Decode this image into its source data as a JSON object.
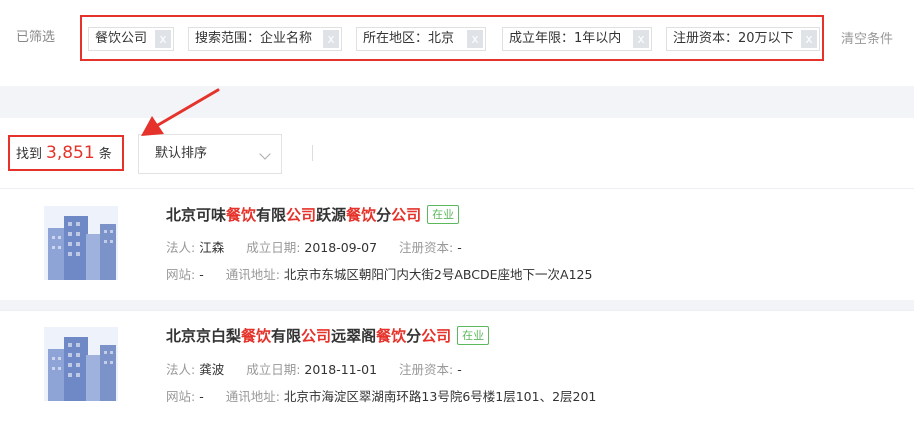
{
  "filters": {
    "label": "已筛选",
    "chips": [
      {
        "text": "餐饮公司",
        "close": "x"
      },
      {
        "text": "搜索范围：企业名称",
        "close": "x"
      },
      {
        "text": "所在地区：北京",
        "close": "x"
      },
      {
        "text": "成立年限：1年以内",
        "close": "x"
      },
      {
        "text": "注册资本：20万以下",
        "close": "x"
      }
    ],
    "clear_label": "清空条件"
  },
  "results": {
    "prefix": "找到",
    "count": "3,851",
    "suffix": "条",
    "sort_label": "默认排序"
  },
  "companies": [
    {
      "name_parts": [
        "北京可味",
        "餐饮",
        "有限",
        "公司",
        "跃源",
        "餐饮",
        "分",
        "公司"
      ],
      "status": "在业",
      "legal_label": "法人:",
      "legal_value": "江森",
      "date_label": "成立日期:",
      "date_value": "2018-09-07",
      "capital_label": "注册资本:",
      "capital_value": "-",
      "site_label": "网站:",
      "site_value": "-",
      "addr_label": "通讯地址:",
      "addr_value": "北京市东城区朝阳门内大街2号ABCDE座地下一次A125"
    },
    {
      "name_parts": [
        "北京京白梨",
        "餐饮",
        "有限",
        "公司",
        "远翠阁",
        "餐饮",
        "分",
        "公司"
      ],
      "status": "在业",
      "legal_label": "法人:",
      "legal_value": "龚波",
      "date_label": "成立日期:",
      "date_value": "2018-11-01",
      "capital_label": "注册资本:",
      "capital_value": "-",
      "site_label": "网站:",
      "site_value": "-",
      "addr_label": "通讯地址:",
      "addr_value": "北京市海淀区翠湖南环路13号院6号楼1层101、2层201"
    }
  ],
  "colors": {
    "highlight_red": "#e5332b",
    "status_green": "#5cb85c",
    "logo_blue": "#7b93c9"
  },
  "icons": {
    "chip_close": "close-icon",
    "sort_arrow": "chevron-down-icon",
    "company_logo": "building-icon",
    "annotation": "arrow-annotation"
  }
}
